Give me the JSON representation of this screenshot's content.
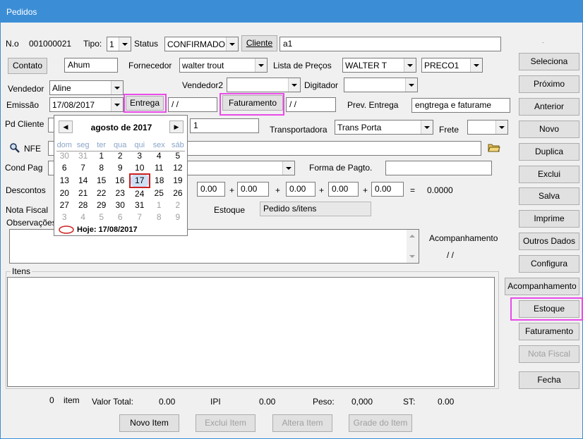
{
  "window": {
    "title": "Pedidos"
  },
  "header": {
    "no_label": "N.o",
    "no_value": "001000021",
    "tipo_label": "Tipo:",
    "tipo_value": "1",
    "status_label": "Status",
    "status_value": "CONFIRMADO",
    "cliente_button": "Cliente",
    "cliente_value": "a1"
  },
  "row2": {
    "contato_button": "Contato",
    "contato_value": "Ahum",
    "fornecedor_label": "Fornecedor",
    "fornecedor_value": "walter trout",
    "lista_label": "Lista de Preços",
    "lista_value": "WALTER T",
    "preco_value": "PRECO1"
  },
  "row3": {
    "vendedor_label": "Vendedor",
    "vendedor_value": "Aline",
    "vendedor2_label": "Vendedor2",
    "vendedor2_value": "",
    "digitador_label": "Digitador",
    "digitador_value": ""
  },
  "row4": {
    "emissao_label": "Emissão",
    "emissao_value": "17/08/2017",
    "entrega_button": "Entrega",
    "entrega_value": " / /",
    "faturamento_button": "Faturamento",
    "faturamento_value": " / /",
    "prev_label": "Prev. Entrega",
    "prev_value": "engtrega e faturame"
  },
  "row5": {
    "pdcliente_label": "Pd Cliente",
    "pdcliente_value": "1",
    "transportadora_label": "Transportadora",
    "transportadora_value": "Trans Porta",
    "frete_label": "Frete",
    "frete_value": ""
  },
  "row6": {
    "nfe_label": "NFE",
    "nfe_value": ""
  },
  "row7": {
    "condpag_label": "Cond Pag",
    "condpag_value": "",
    "forma_label": "Forma de Pagto.",
    "forma_value": ""
  },
  "descontos": {
    "label": "Descontos",
    "values": [
      "0.00",
      "0.00",
      "0.00",
      "0.00",
      "0.00"
    ],
    "plus": "+",
    "equals": "=",
    "total": "0.0000"
  },
  "row9": {
    "notafiscal_label": "Nota Fiscal",
    "estoque_label": "Estoque",
    "estoque_value": "Pedido s/itens"
  },
  "obs": {
    "label": "Observações",
    "acompanhamento_label": "Acompanhamento",
    "acompanhamento_value": "/ /"
  },
  "itens": {
    "label": "Itens"
  },
  "footer": {
    "count": "0",
    "item_label": "item",
    "valor_label": "Valor Total:",
    "valor_value": "0.00",
    "ipi_label": "IPI",
    "ipi_value": "0.00",
    "peso_label": "Peso:",
    "peso_value": "0,000",
    "st_label": "ST:",
    "st_value": "0.00",
    "novo_item": "Novo Item",
    "exclui_item": "Exclui Item",
    "altera_item": "Altera Item",
    "grade_item": "Grade do Item"
  },
  "calendar": {
    "month": "agosto de 2017",
    "weekdays": [
      "dom",
      "seg",
      "ter",
      "qua",
      "qui",
      "sex",
      "sáb"
    ],
    "weeks": [
      [
        "30",
        "31",
        "1",
        "2",
        "3",
        "4",
        "5"
      ],
      [
        "6",
        "7",
        "8",
        "9",
        "10",
        "11",
        "12"
      ],
      [
        "13",
        "14",
        "15",
        "16",
        "17",
        "18",
        "19"
      ],
      [
        "20",
        "21",
        "22",
        "23",
        "24",
        "25",
        "26"
      ],
      [
        "27",
        "28",
        "29",
        "30",
        "31",
        "1",
        "2"
      ],
      [
        "3",
        "4",
        "5",
        "6",
        "7",
        "8",
        "9"
      ]
    ],
    "today": "Hoje: 17/08/2017"
  },
  "sidebar": {
    "seleciona": "Seleciona",
    "proximo": "Próximo",
    "anterior": "Anterior",
    "novo": "Novo",
    "duplica": "Duplica",
    "exclui": "Exclui",
    "salva": "Salva",
    "imprime": "Imprime",
    "outros": "Outros Dados",
    "configura": "Configura",
    "acompanhamento": "Acompanhamento",
    "estoque": "Estoque",
    "faturamento": "Faturamento",
    "nota_fiscal": "Nota Fiscal",
    "fecha": "Fecha"
  },
  "colors": {
    "titlebar": "#3b8ed6",
    "highlight": "#e84be8"
  }
}
